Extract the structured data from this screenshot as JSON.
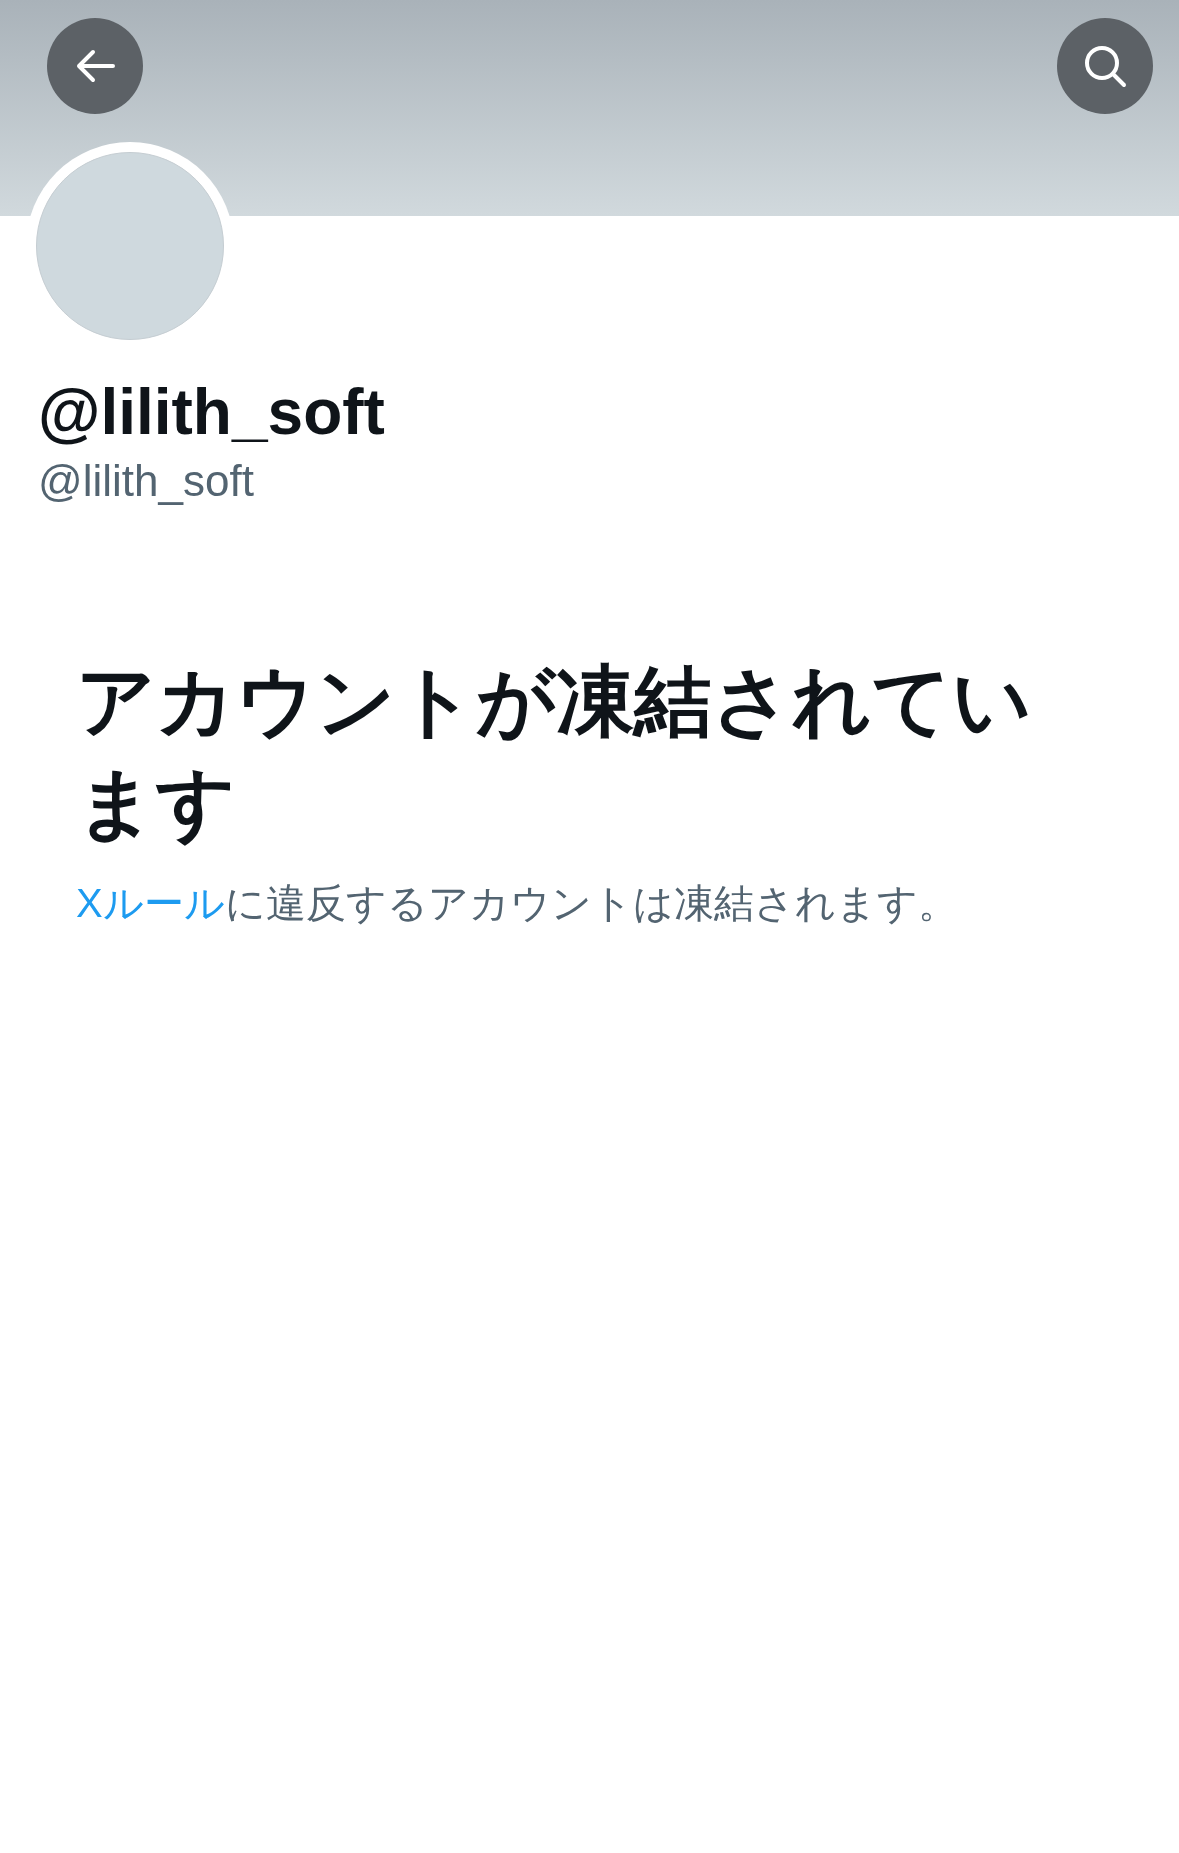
{
  "profile": {
    "display_name": "@lilith_soft",
    "handle": "@lilith_soft"
  },
  "notice": {
    "title": "アカウントが凍結されています",
    "link": "Xルール",
    "text": "に違反するアカウントは凍結されます。"
  }
}
